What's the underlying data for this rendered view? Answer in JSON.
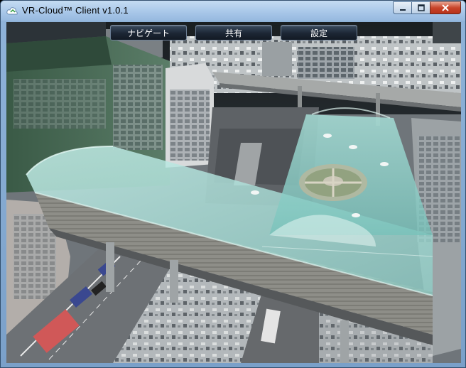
{
  "window": {
    "title": "VR-Cloud™ Client v1.0.1",
    "controls": [
      "minimize",
      "maximize",
      "close"
    ]
  },
  "toolbar": {
    "navigate_label": "ナビゲート",
    "share_label": "共有",
    "settings_label": "設定"
  },
  "viewport": {
    "content": "3d-city-scene",
    "icons": {
      "app": "cloud-icon"
    }
  },
  "colors": {
    "glass_roof": "#a8d8d0",
    "toolbar_button": "#1c2634",
    "titlebar": "#a7c6e8"
  }
}
